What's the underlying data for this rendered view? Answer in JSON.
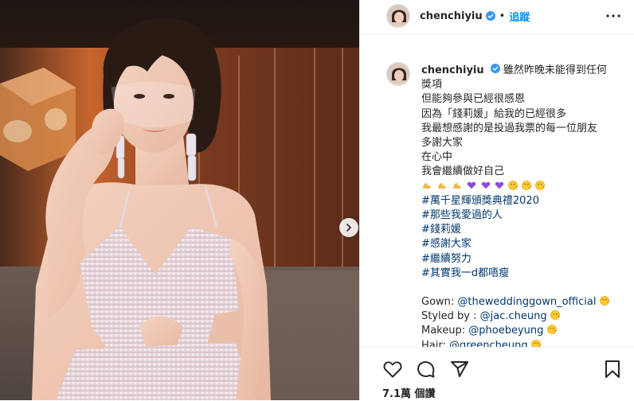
{
  "header": {
    "username": "chenchiyiu",
    "separator": "•",
    "follow_label": "追蹤",
    "verified_icon": "verified-badge-icon",
    "more_icon": "more-options-icon"
  },
  "caption": {
    "username": "chenchiyiu",
    "lines": [
      "雖然昨晚未能得到任何",
      "獎項",
      "但能夠參與已經很感恩",
      "因為「錢莉媛」給我的已經很多",
      "我最想感謝的是投過我票的每一位朋友",
      "多謝大家",
      "在心中",
      "我會繼續做好自己"
    ],
    "emoji_line": [
      "arm-emoji",
      "arm-emoji",
      "arm-emoji",
      "purple-heart",
      "purple-heart",
      "purple-heart",
      "kiss-face",
      "kiss-face",
      "kiss-face"
    ],
    "hashtags": [
      "#萬千星輝頒獎典禮2020",
      "#那些我愛過的人",
      "#錢莉媛",
      "#感謝大家",
      "#繼續努力",
      "#其實我一d都唔瘦"
    ],
    "credits": [
      {
        "label": "Gown: ",
        "mention": "@theweddinggown_official"
      },
      {
        "label": "Styled by : ",
        "mention": "@jac.cheung"
      },
      {
        "label": "Makeup: ",
        "mention": "@phoebeyung"
      },
      {
        "label": "Hair: ",
        "mention": "@greencheung"
      }
    ]
  },
  "actions": {
    "like_icon": "heart-icon",
    "comment_icon": "comment-icon",
    "share_icon": "share-icon",
    "save_icon": "bookmark-icon",
    "views_text": "7.1萬 個讚"
  },
  "colors": {
    "accent": "#0095f6",
    "link": "#00376b",
    "text": "#262626",
    "border": "#efefef"
  }
}
